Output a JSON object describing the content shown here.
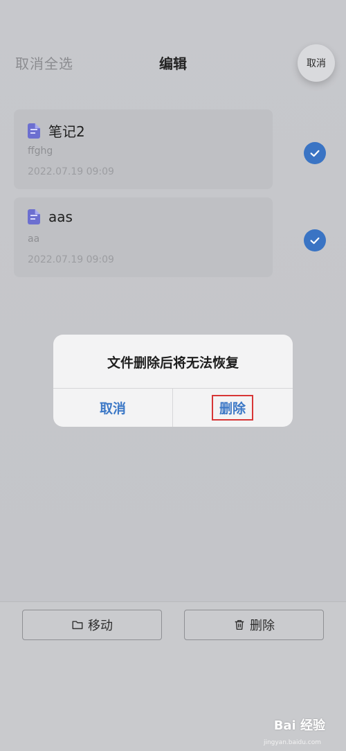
{
  "header": {
    "select_all": "取消全选",
    "title": "编辑",
    "cancel": "取消"
  },
  "notes": [
    {
      "title": "笔记2",
      "snippet": "ffghg",
      "date": "2022.07.19 09:09",
      "icon": "document-icon",
      "checked": true
    },
    {
      "title": "aas",
      "snippet": "aa",
      "date": "2022.07.19 09:09",
      "icon": "document-icon",
      "checked": true
    }
  ],
  "dialog": {
    "message": "文件删除后将无法恢复",
    "cancel": "取消",
    "delete": "删除"
  },
  "bottom": {
    "move": "移动",
    "delete": "删除",
    "move_icon": "folder-icon",
    "delete_icon": "trash-icon"
  },
  "watermark": {
    "brand": "Bai 经验",
    "url": "jingyan.baidu.com"
  },
  "colors": {
    "accent": "#3a74c4",
    "doc_icon": "#6c6fd0",
    "highlight_box": "#d73636"
  }
}
